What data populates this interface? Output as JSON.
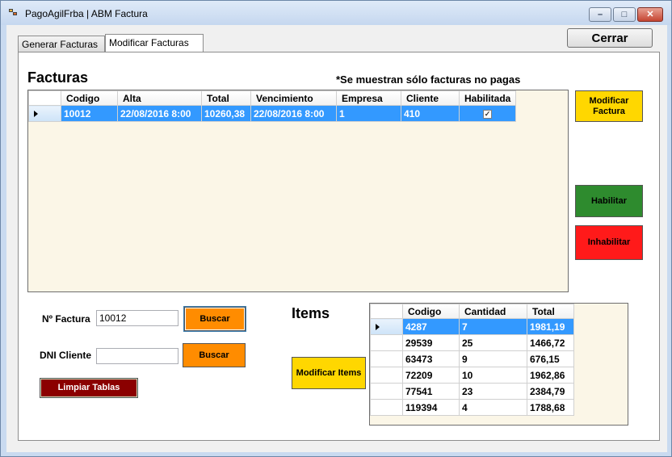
{
  "window": {
    "title": "PagoAgilFrba | ABM Factura"
  },
  "tabs": [
    {
      "label": "Generar Facturas"
    },
    {
      "label": "Modificar Facturas"
    }
  ],
  "close_button": "Cerrar",
  "facturas": {
    "heading": "Facturas",
    "note": "*Se muestran sólo facturas no pagas",
    "columns": [
      "Codigo",
      "Alta",
      "Total",
      "Vencimiento",
      "Empresa",
      "Cliente",
      "Habilitada"
    ],
    "rows": [
      {
        "codigo": "10012",
        "alta": "22/08/2016 8:00",
        "total": "10260,38",
        "vencimiento": "22/08/2016 8:00",
        "empresa": "1",
        "cliente": "410",
        "habilitada": "✓"
      }
    ]
  },
  "actions": {
    "modificar_factura": "Modificar Factura",
    "habilitar": "Habilitar",
    "inhabilitar": "Inhabilitar"
  },
  "search": {
    "factura_label": "Nº Factura",
    "factura_value": "10012",
    "dni_label": "DNI Cliente",
    "dni_value": "",
    "buscar": "Buscar",
    "limpiar": "Limpiar Tablas"
  },
  "items": {
    "heading": "Items",
    "modificar": "Modificar Items",
    "columns": [
      "Codigo",
      "Cantidad",
      "Total"
    ],
    "rows": [
      {
        "codigo": "4287",
        "cantidad": "7",
        "total": "1981,19"
      },
      {
        "codigo": "29539",
        "cantidad": "25",
        "total": "1466,72"
      },
      {
        "codigo": "63473",
        "cantidad": "9",
        "total": "676,15"
      },
      {
        "codigo": "72209",
        "cantidad": "10",
        "total": "1962,86"
      },
      {
        "codigo": "77541",
        "cantidad": "23",
        "total": "2384,79"
      },
      {
        "codigo": "119394",
        "cantidad": "4",
        "total": "1788,68"
      }
    ]
  },
  "colors": {
    "selection": "#3399ff",
    "grid_bg": "#fbf6e7",
    "yellow": "#ffd700",
    "green": "#2e8b2e",
    "red": "#ff1a1a",
    "orange": "#ff8c00",
    "maroon": "#8b0000"
  }
}
